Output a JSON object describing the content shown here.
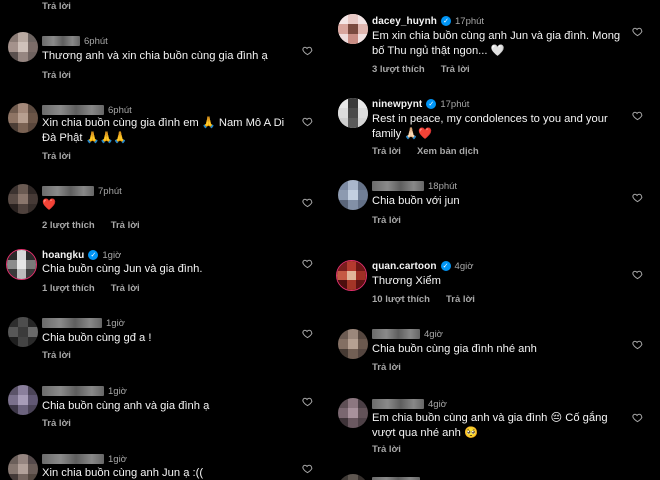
{
  "actions": {
    "reply": "Trả lời",
    "see_translation": "Xem bản dịch"
  },
  "left": [
    {
      "top": "0",
      "text": "",
      "meta": [
        "Trả lời"
      ]
    },
    {
      "time": "6phút",
      "text": "Thương anh và xin chia buồn cùng gia đình ạ",
      "meta": [
        "Trả lời"
      ]
    },
    {
      "time": "6phút",
      "text": "Xin chia buồn cùng gia đình em 🙏 Nam Mô A Di Đà Phật 🙏🙏🙏",
      "meta": [
        "Trả lời"
      ]
    },
    {
      "time": "7phút",
      "text": "❤️",
      "meta": [
        "2 lượt thích",
        "Trả lời"
      ]
    },
    {
      "username": "hoangku",
      "time": "1giờ",
      "text": "Chia buồn cùng Jun và gia đình.",
      "meta": [
        "1 lượt thích",
        "Trả lời"
      ]
    },
    {
      "time": "1giờ",
      "text": "Chia buồn cùng gđ a !",
      "meta": [
        "Trả lời"
      ]
    },
    {
      "time": "1giờ",
      "text": "Chia buồn cùng anh và gia đình ạ",
      "meta": [
        "Trả lời"
      ]
    },
    {
      "time": "1giờ",
      "text": "Xin chia buồn cùng anh Jun ạ :((",
      "meta": []
    }
  ],
  "right": [
    {
      "username": "dacey_huynh",
      "time": "17phút",
      "text": "Em xin chia buồn cùng anh Jun và gia đình. Mong bố Thu ngủ thật ngon... 🤍",
      "meta": [
        "3 lượt thích",
        "Trả lời"
      ]
    },
    {
      "username": "ninewpynt",
      "time": "17phút",
      "text": "Rest in peace, my condolences to you and your family 🙏🏻❤️",
      "meta": [
        "Trả lời",
        "Xem bản dịch"
      ]
    },
    {
      "time": "18phút",
      "text": "Chia buồn với jun",
      "meta": [
        "Trả lời"
      ]
    },
    {
      "username": "quan.cartoon",
      "time": "4giờ",
      "text": "Thương Xiểm",
      "meta": [
        "10 lượt thích",
        "Trả lời"
      ]
    },
    {
      "time": "4giờ",
      "text": "Chia buồn cùng gia đình nhé anh",
      "meta": [
        "Trả lời"
      ]
    },
    {
      "time": "4giờ",
      "text": "Em chia buồn cùng anh và gia đình 😔 Cố gắng vượt qua nhé anh 🥺",
      "meta": [
        "Trả lời"
      ]
    }
  ],
  "colors": {
    "background": "#000000",
    "text": "#f5f5f5",
    "muted": "#a8a8a8",
    "verified": "#0095f6",
    "like_red": "#ff2d3c"
  },
  "icons": [
    "heart-outline-icon",
    "verified-badge-icon"
  ]
}
